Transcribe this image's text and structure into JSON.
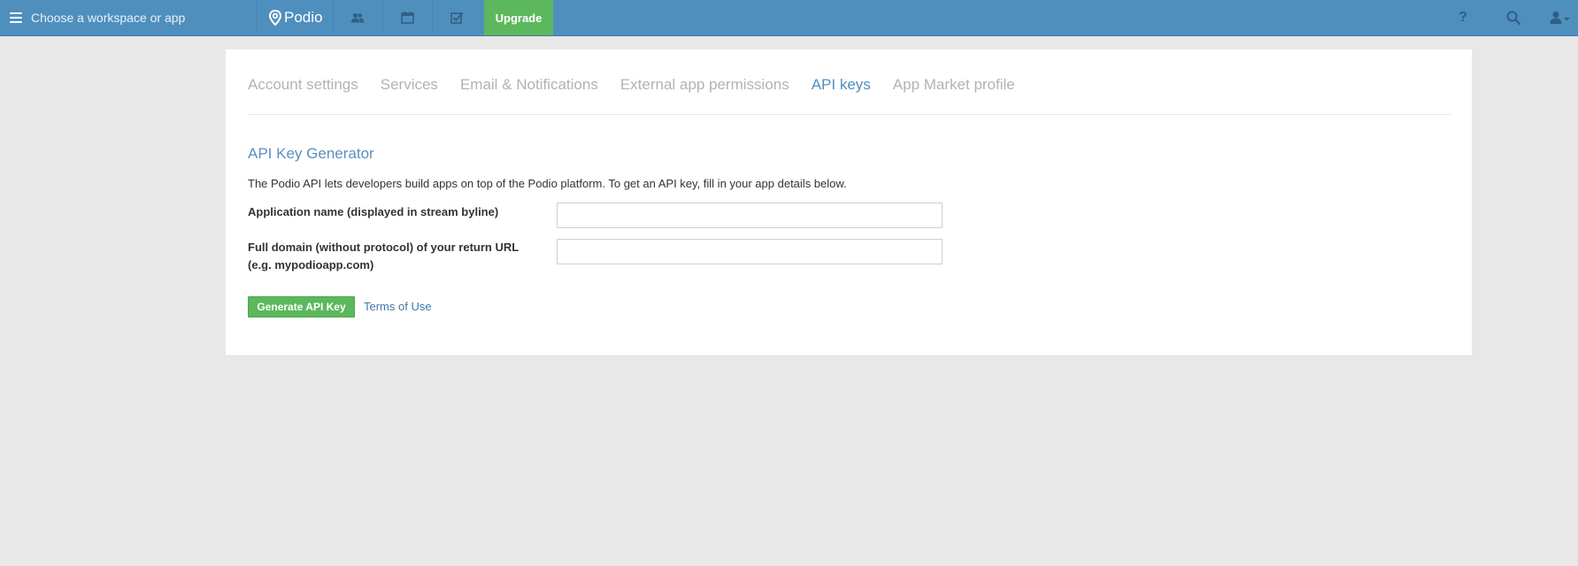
{
  "topbar": {
    "workspace_switcher_label": "Choose a workspace or app",
    "logo_text": "Podio",
    "nav_icons": [
      "contacts-icon",
      "calendar-icon",
      "tasks-icon"
    ],
    "upgrade_label": "Upgrade",
    "right_icons": [
      "help-icon",
      "search-icon",
      "user-menu-icon"
    ],
    "help_glyph": "?"
  },
  "tabs": [
    {
      "label": "Account settings",
      "active": false
    },
    {
      "label": "Services",
      "active": false
    },
    {
      "label": "Email & Notifications",
      "active": false
    },
    {
      "label": "External app permissions",
      "active": false
    },
    {
      "label": "API keys",
      "active": true
    },
    {
      "label": "App Market profile",
      "active": false
    }
  ],
  "api_generator": {
    "title": "API Key Generator",
    "intro": "The Podio API lets developers build apps on top of the Podio platform. To get an API key, fill in your app details below.",
    "app_name_label": "Application name (displayed in stream byline)",
    "app_name_value": "",
    "domain_label_line1": "Full domain (without protocol) of your return URL",
    "domain_label_line2": "(e.g. mypodioapp.com)",
    "domain_value": "",
    "generate_button": "Generate API Key",
    "terms_link": "Terms of Use"
  },
  "colors": {
    "topbar": "#4f8fbe",
    "upgrade": "#5cb85c",
    "accent": "#4f8fbe",
    "background": "#e8e8e8"
  }
}
